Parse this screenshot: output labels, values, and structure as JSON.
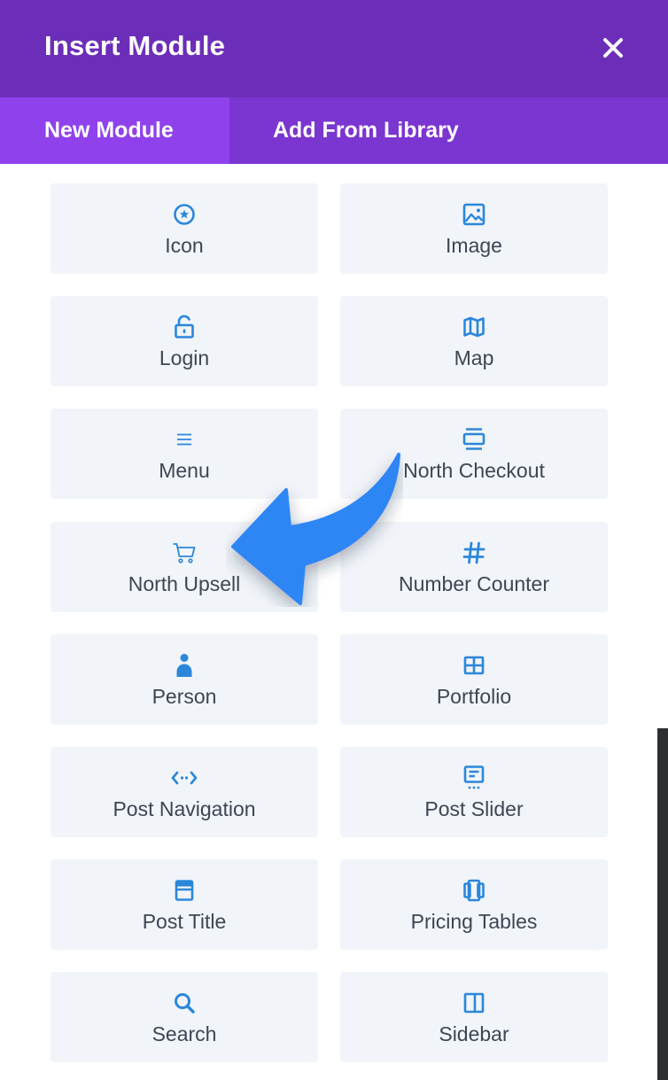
{
  "header": {
    "title": "Insert Module",
    "close_icon": "close-icon"
  },
  "tabs": [
    {
      "label": "New Module",
      "active": true
    },
    {
      "label": "Add From Library",
      "active": false
    }
  ],
  "modules": [
    {
      "label": "Icon",
      "icon": "circle-star-icon"
    },
    {
      "label": "Image",
      "icon": "image-icon"
    },
    {
      "label": "Login",
      "icon": "unlock-icon"
    },
    {
      "label": "Map",
      "icon": "map-icon"
    },
    {
      "label": "Menu",
      "icon": "menu-icon"
    },
    {
      "label": "North Checkout",
      "icon": "checkout-icon"
    },
    {
      "label": "North Upsell",
      "icon": "cart-icon"
    },
    {
      "label": "Number Counter",
      "icon": "hash-icon"
    },
    {
      "label": "Person",
      "icon": "person-icon"
    },
    {
      "label": "Portfolio",
      "icon": "portfolio-grid-icon"
    },
    {
      "label": "Post Navigation",
      "icon": "post-navigation-icon"
    },
    {
      "label": "Post Slider",
      "icon": "post-slider-icon"
    },
    {
      "label": "Post Title",
      "icon": "post-title-icon"
    },
    {
      "label": "Pricing Tables",
      "icon": "pricing-tables-icon"
    },
    {
      "label": "Search",
      "icon": "search-icon"
    },
    {
      "label": "Sidebar",
      "icon": "sidebar-icon"
    }
  ],
  "colors": {
    "header_bg": "#6c2eb9",
    "tabs_bg": "#7b35d1",
    "active_tab_bg": "#8f42ec",
    "icon_blue": "#2b87da",
    "arrow_blue": "#2e86f5",
    "module_bg": "#f1f4f8",
    "label_text": "#3d4653"
  }
}
